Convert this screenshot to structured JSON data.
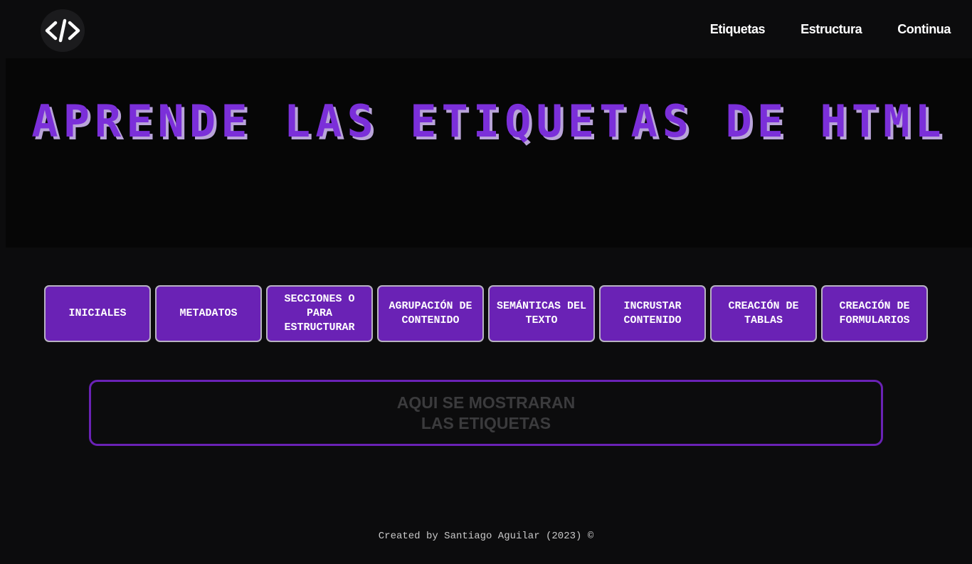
{
  "header": {
    "logo_icon": "code-icon",
    "nav": [
      {
        "label": "Etiquetas"
      },
      {
        "label": "Estructura"
      },
      {
        "label": "Continua"
      }
    ]
  },
  "hero": {
    "title": "Aprende las etiquetas de HTML"
  },
  "categories": [
    {
      "label": "INICIALES"
    },
    {
      "label": "METADATOS"
    },
    {
      "label": "SECCIONES O PARA ESTRUCTURAR"
    },
    {
      "label": "AGRUPACIÓN DE CONTENIDO"
    },
    {
      "label": "SEMÁNTICAS DEL TEXTO"
    },
    {
      "label": "INCRUSTAR CONTENIDO"
    },
    {
      "label": "CREACIÓN DE TABLAS"
    },
    {
      "label": "CREACIÓN DE FORMULARIOS"
    }
  ],
  "display": {
    "placeholder": "AQUI SE MOSTRARAN LAS ETIQUETAS"
  },
  "footer": {
    "text": "Created by Santiago Aguilar (2023) ©"
  },
  "colors": {
    "background": "#0c0c0d",
    "accent": "#6a22b5",
    "title_purple": "#7b2fd9",
    "title_shadow": "#b9a4d9"
  }
}
